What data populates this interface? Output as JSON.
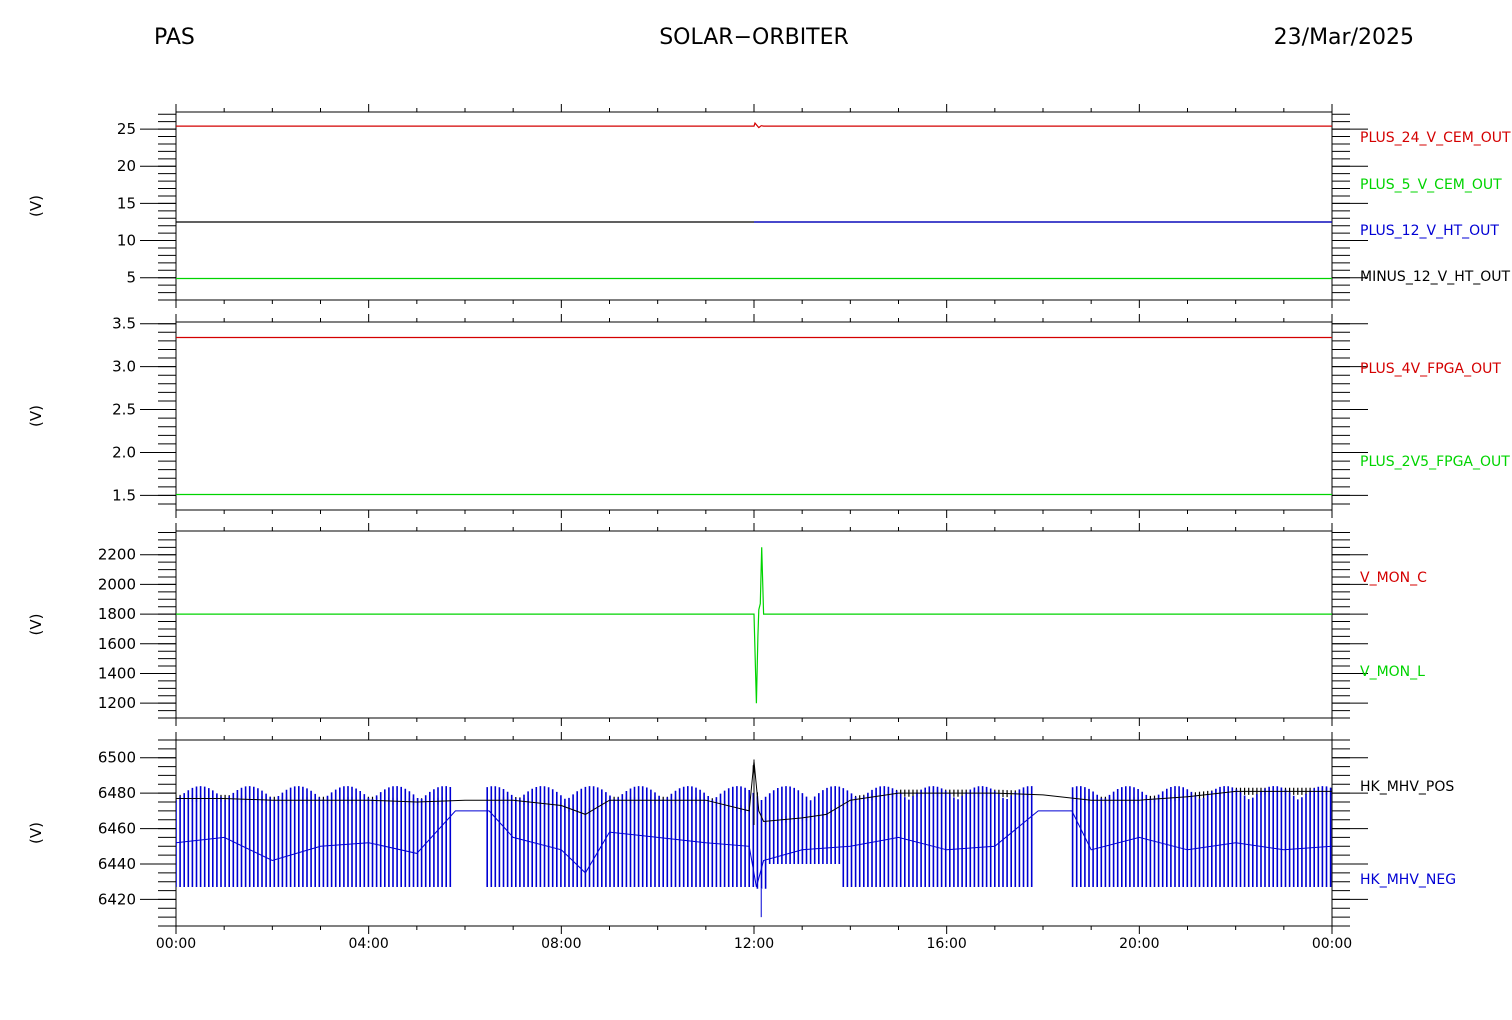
{
  "header": {
    "left": "PAS",
    "center": "SOLAR−ORBITER",
    "right": "23/Mar/2025"
  },
  "chart_data": [
    {
      "type": "line",
      "ylabel": "(V)",
      "ylim": [
        2,
        27.3
      ],
      "yticks": [
        5,
        10,
        15,
        20,
        25
      ],
      "y_minor_step": 1,
      "x_range_hours": [
        0,
        24
      ],
      "legend": [
        {
          "name": "PLUS_24_V_CEM_OUT",
          "color": "#d40000"
        },
        {
          "name": "PLUS_5_V_CEM_OUT",
          "color": "#00d400"
        },
        {
          "name": "PLUS_12_V_HT_OUT",
          "color": "#0000d4"
        },
        {
          "name": "MINUS_12_V_HT_OUT",
          "color": "#000000"
        }
      ],
      "series": [
        {
          "name": "PLUS_24_V_CEM_OUT",
          "color": "#d40000",
          "x": [
            0,
            12,
            12.02,
            12.1,
            12.15,
            12.2,
            24
          ],
          "y": [
            25.4,
            25.4,
            25.8,
            25.2,
            25.45,
            25.4,
            25.4
          ]
        },
        {
          "name": "PLUS_5_V_CEM_OUT",
          "color": "#00d400",
          "x": [
            0,
            24
          ],
          "y": [
            4.9,
            4.9
          ]
        },
        {
          "name": "MINUS_12_V_HT_OUT",
          "color": "#000000",
          "x": [
            0,
            12,
            24
          ],
          "y": [
            12.5,
            12.5,
            12.5
          ]
        },
        {
          "name": "PLUS_12_V_HT_OUT",
          "color": "#0000d4",
          "x": [
            12,
            24
          ],
          "y": [
            12.5,
            12.5
          ]
        }
      ]
    },
    {
      "type": "line",
      "ylabel": "(V)",
      "ylim": [
        1.33,
        3.52
      ],
      "yticks": [
        1.5,
        2.0,
        2.5,
        3.0,
        3.5
      ],
      "ytick_labels": [
        "1.5",
        "2.0",
        "2.5",
        "3.0",
        "3.5"
      ],
      "y_minor_step": 0.1,
      "x_range_hours": [
        0,
        24
      ],
      "legend": [
        {
          "name": "PLUS_4V_FPGA_OUT",
          "color": "#d40000"
        },
        {
          "name": "PLUS_2V5_FPGA_OUT",
          "color": "#00d400"
        }
      ],
      "series": [
        {
          "name": "PLUS_4V_FPGA_OUT",
          "color": "#d40000",
          "x": [
            0,
            24
          ],
          "y": [
            3.34,
            3.34
          ]
        },
        {
          "name": "PLUS_2V5_FPGA_OUT",
          "color": "#00d400",
          "x": [
            0,
            24
          ],
          "y": [
            1.51,
            1.51
          ]
        }
      ]
    },
    {
      "type": "line",
      "ylabel": "(V)",
      "ylim": [
        1100,
        2360
      ],
      "yticks": [
        1200,
        1400,
        1600,
        1800,
        2000,
        2200
      ],
      "y_minor_step": 50,
      "x_range_hours": [
        0,
        24
      ],
      "legend": [
        {
          "name": "V_MON_C",
          "color": "#d40000"
        },
        {
          "name": "V_MON_L",
          "color": "#00d400"
        }
      ],
      "series": [
        {
          "name": "V_MON_L",
          "color": "#00d400",
          "x": [
            0,
            12.0,
            12.05,
            12.08,
            12.1,
            12.13,
            12.16,
            12.2,
            24
          ],
          "y": [
            1800,
            1800,
            1200,
            1650,
            1830,
            1870,
            2250,
            1800,
            1800
          ]
        }
      ]
    },
    {
      "type": "line",
      "ylabel": "(V)",
      "ylim": [
        6405,
        6510
      ],
      "yticks": [
        6420,
        6440,
        6460,
        6480,
        6500
      ],
      "y_minor_step": 5,
      "x_range_hours": [
        0,
        24
      ],
      "xticks": [
        "00:00",
        "04:00",
        "08:00",
        "12:00",
        "16:00",
        "20:00",
        "00:00"
      ],
      "legend": [
        {
          "name": "HK_MHV_POS",
          "color": "#000000"
        },
        {
          "name": "HK_MHV_NEG",
          "color": "#0000d4"
        }
      ],
      "series": [
        {
          "name": "HK_MHV_POS",
          "color": "#000000",
          "x": [
            0,
            1,
            2,
            3,
            4,
            5,
            6,
            7,
            8,
            8.5,
            9,
            10,
            11,
            11.9,
            12.0,
            12.1,
            12.2,
            13,
            13.5,
            14,
            15,
            16,
            17,
            18,
            19,
            20,
            21,
            22,
            23,
            24
          ],
          "y": [
            6477,
            6477,
            6476,
            6476,
            6476,
            6475,
            6476,
            6476,
            6473,
            6468,
            6476,
            6476,
            6476,
            6470,
            6498,
            6470,
            6464,
            6466,
            6468,
            6476,
            6480,
            6480,
            6480,
            6479,
            6476,
            6476,
            6478,
            6481,
            6481,
            6481
          ]
        },
        {
          "name": "HK_MHV_NEG",
          "color": "#0000d4",
          "x": [
            0,
            1,
            2,
            3,
            4,
            5,
            5.8,
            6.5,
            7,
            8,
            8.5,
            9,
            10,
            11,
            11.9,
            12.05,
            12.2,
            13,
            14,
            15,
            16,
            17,
            17.9,
            18.6,
            19,
            20,
            21,
            22,
            23,
            24
          ],
          "y": [
            6452,
            6455,
            6442,
            6450,
            6452,
            6446,
            6470,
            6470,
            6455,
            6448,
            6435,
            6458,
            6455,
            6452,
            6450,
            6427,
            6442,
            6448,
            6450,
            6455,
            6448,
            6450,
            6470,
            6470,
            6448,
            6455,
            6448,
            6452,
            6448,
            6450
          ]
        }
      ]
    }
  ]
}
